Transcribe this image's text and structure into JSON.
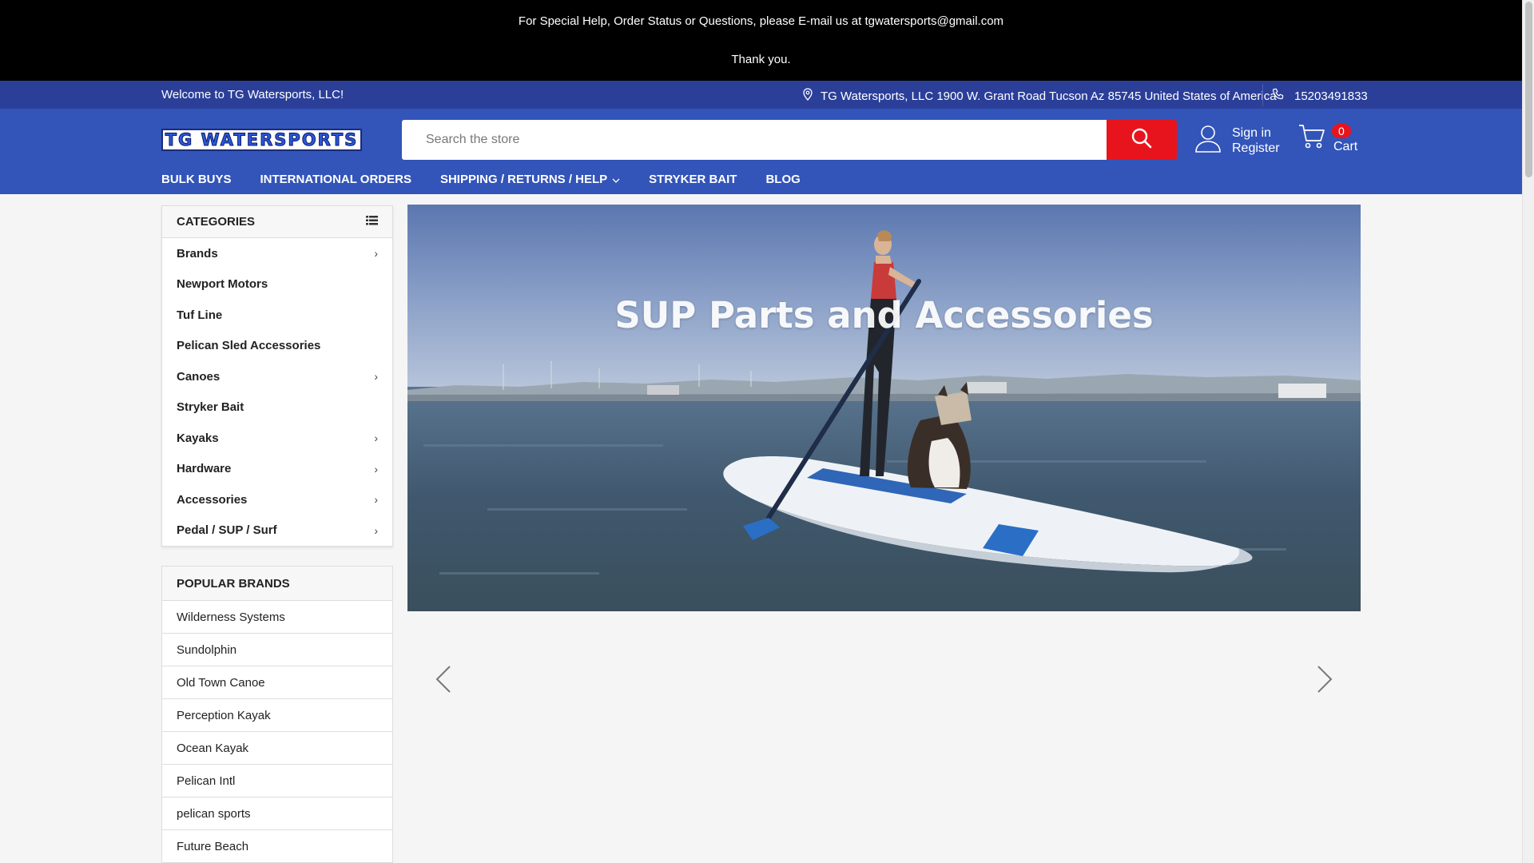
{
  "announcement": {
    "line1": "For Special Help, Order Status or Questions, please E-mail us at tgwatersports@gmail.com",
    "line2": "Thank you."
  },
  "infobar": {
    "welcome": "Welcome to TG Watersports, LLC!",
    "address": "TG Watersports, LLC 1900 W. Grant Road Tucson Az 85745 United States of America",
    "phone": "15203491833"
  },
  "header": {
    "logo_text": "TG WATERSPORTS",
    "search_placeholder": "Search the store",
    "sign_in": "Sign in",
    "register": "Register",
    "cart_label": "Cart",
    "cart_count": "0"
  },
  "nav": [
    {
      "label": "BULK BUYS"
    },
    {
      "label": "INTERNATIONAL ORDERS"
    },
    {
      "label": "SHIPPING / RETURNS / HELP",
      "has_dropdown": true
    },
    {
      "label": "STRYKER BAIT"
    },
    {
      "label": "BLOG"
    }
  ],
  "categories": {
    "title": "CATEGORIES",
    "items": [
      {
        "label": "Brands",
        "has_children": true
      },
      {
        "label": "Newport Motors",
        "has_children": false
      },
      {
        "label": "Tuf Line",
        "has_children": false
      },
      {
        "label": "Pelican Sled Accessories",
        "has_children": false
      },
      {
        "label": "Canoes",
        "has_children": true
      },
      {
        "label": "Stryker Bait",
        "has_children": false
      },
      {
        "label": "Kayaks",
        "has_children": true
      },
      {
        "label": "Hardware",
        "has_children": true
      },
      {
        "label": "Accessories",
        "has_children": true
      },
      {
        "label": "Pedal / SUP / Surf",
        "has_children": true
      }
    ]
  },
  "popular_brands": {
    "title": "POPULAR BRANDS",
    "items": [
      "Wilderness Systems",
      "Sundolphin",
      "Old Town Canoe",
      "Perception Kayak",
      "Ocean Kayak",
      "Pelican Intl",
      "pelican sports",
      "Future Beach"
    ]
  },
  "hero": {
    "title": "SUP Parts and Accessories"
  },
  "colors": {
    "accent_blue": "#3355b9",
    "infobar_blue": "#2b3f99",
    "cart_badge_red": "#e8141d",
    "search_button_red": "#e8141d"
  },
  "icons": {
    "announce": "none",
    "address": "map-pin-icon",
    "phone": "phone-icon",
    "search": "search-icon",
    "account": "user-icon",
    "cart": "cart-icon",
    "categories_toggle": "list-icon",
    "slider_prev": "chevron-left-icon",
    "slider_next": "chevron-right-icon"
  }
}
